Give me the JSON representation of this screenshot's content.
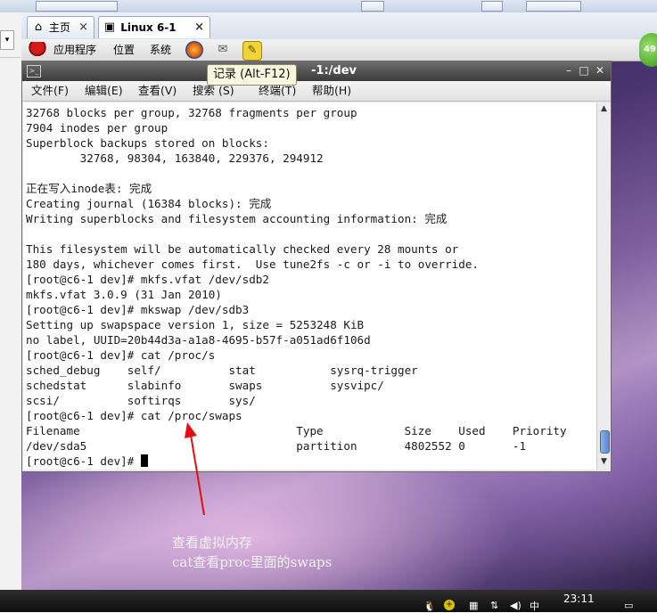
{
  "tabs": [
    {
      "label": "主页",
      "icon": "home-icon",
      "close": "×"
    },
    {
      "label": "Linux 6-1",
      "icon": "vm-icon",
      "close": "×"
    }
  ],
  "panel": {
    "menus": [
      "应用程序",
      "位置",
      "系统"
    ]
  },
  "badge": "49",
  "terminal": {
    "title": "-1:/dev",
    "tooltip": "记录 (Alt-F12)",
    "menu": [
      "文件(F)",
      "编辑(E)",
      "查看(V)",
      "搜索 (S)",
      "终端(T)",
      "帮助(H)"
    ],
    "lines": [
      "32768 blocks per group, 32768 fragments per group",
      "7904 inodes per group",
      "Superblock backups stored on blocks:",
      "        32768, 98304, 163840, 229376, 294912",
      "",
      "正在写入inode表: 完成",
      "Creating journal (16384 blocks): 完成",
      "Writing superblocks and filesystem accounting information: 完成",
      "",
      "This filesystem will be automatically checked every 28 mounts or",
      "180 days, whichever comes first.  Use tune2fs -c or -i to override.",
      "[root@c6-1 dev]# mkfs.vfat /dev/sdb2",
      "mkfs.vfat 3.0.9 (31 Jan 2010)",
      "[root@c6-1 dev]# mkswap /dev/sdb3",
      "Setting up swapspace version 1, size = 5253248 KiB",
      "no label, UUID=20b44d3a-a1a8-4695-b57f-a051ad6f106d",
      "[root@c6-1 dev]# cat /proc/s",
      "sched_debug    self/          stat           sysrq-trigger",
      "schedstat      slabinfo       swaps          sysvipc/",
      "scsi/          softirqs       sys/",
      "[root@c6-1 dev]# cat /proc/swaps",
      "Filename                                Type            Size    Used    Priority",
      "/dev/sda5                               partition       4802552 0       -1"
    ],
    "prompt": "[root@c6-1 dev]# "
  },
  "annotation": {
    "line1": "查看虚拟内存",
    "line2": "cat查看proc里面的swaps"
  },
  "taskbar": {
    "clock": "23:11",
    "ime": "中"
  }
}
